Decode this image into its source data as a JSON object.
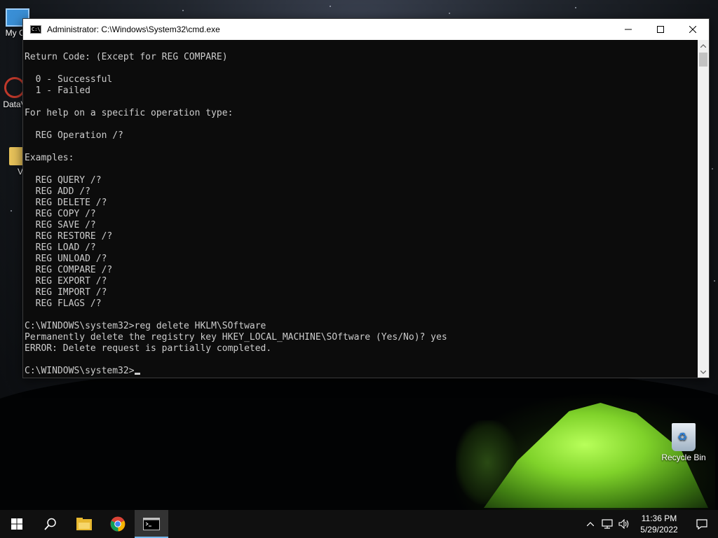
{
  "desktop": {
    "icons": [
      {
        "label": "My Co"
      },
      {
        "label": "DataV"
      },
      {
        "label": "V"
      },
      {
        "label": "Recycle Bin"
      }
    ]
  },
  "window": {
    "title": "Administrator: C:\\Windows\\System32\\cmd.exe",
    "icon": "cmd-icon",
    "buttons": [
      "minimize-icon",
      "maximize-icon",
      "close-icon"
    ]
  },
  "console": {
    "lines": [
      "Return Code: (Except for REG COMPARE)",
      "",
      "  0 - Successful",
      "  1 - Failed",
      "",
      "For help on a specific operation type:",
      "",
      "  REG Operation /?",
      "",
      "Examples:",
      "",
      "  REG QUERY /?",
      "  REG ADD /?",
      "  REG DELETE /?",
      "  REG COPY /?",
      "  REG SAVE /?",
      "  REG RESTORE /?",
      "  REG LOAD /?",
      "  REG UNLOAD /?",
      "  REG COMPARE /?",
      "  REG EXPORT /?",
      "  REG IMPORT /?",
      "  REG FLAGS /?",
      "",
      "C:\\WINDOWS\\system32>reg delete HKLM\\SOftware",
      "Permanently delete the registry key HKEY_LOCAL_MACHINE\\SOftware (Yes/No)? yes",
      "ERROR: Delete request is partially completed.",
      ""
    ],
    "prompt": "C:\\WINDOWS\\system32>"
  },
  "taskbar": {
    "items": [
      "start-icon",
      "search-icon",
      "file-explorer-icon",
      "chrome-icon",
      "cmd-icon"
    ],
    "tray": {
      "icons": [
        "chevron-up-icon",
        "network-icon",
        "volume-icon"
      ],
      "time": "11:36 PM",
      "date": "5/29/2022",
      "notification_icon": "notification-icon"
    }
  },
  "colors": {
    "console_bg": "#0c0c0c",
    "console_fg": "#cccccc",
    "taskbar_bg": "#101010",
    "active_indicator": "#76b9ed"
  }
}
